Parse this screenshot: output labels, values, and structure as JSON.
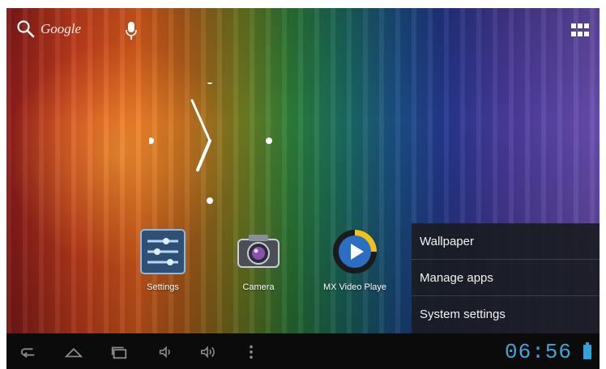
{
  "search": {
    "label": "Google",
    "icon": "search-icon"
  },
  "mic": {
    "icon": "mic-icon"
  },
  "all_apps": {
    "icon": "apps-grid-icon"
  },
  "home_apps": [
    {
      "label": "Settings",
      "icon": "settings-icon"
    },
    {
      "label": "Camera",
      "icon": "camera-icon"
    },
    {
      "label": "MX Video Playe",
      "icon": "video-player-icon"
    }
  ],
  "context_menu": {
    "items": [
      {
        "label": "Wallpaper"
      },
      {
        "label": "Manage apps"
      },
      {
        "label": "System settings"
      }
    ]
  },
  "navbar": {
    "time": "06:56",
    "buttons": [
      "back-icon",
      "home-icon",
      "recent-apps-icon",
      "volume-down-icon",
      "volume-up-icon",
      "menu-dots-icon"
    ],
    "accent": "#41a5d8"
  }
}
